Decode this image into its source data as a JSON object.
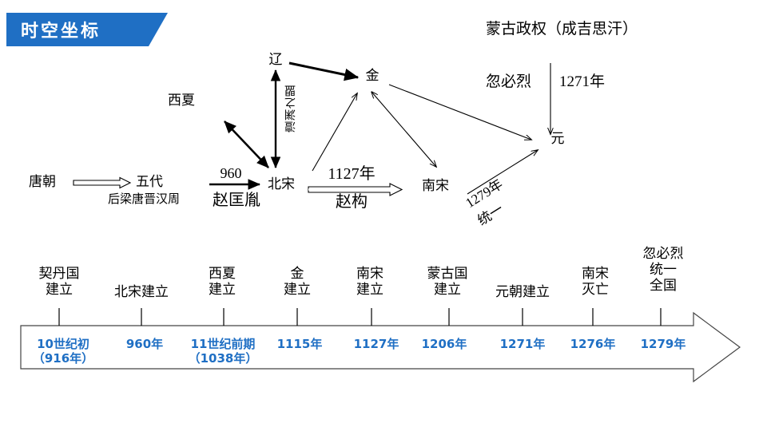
{
  "banner": {
    "title": "时空坐标"
  },
  "colors": {
    "brand": "#1f6fc4",
    "accent": "#1f6fc4",
    "line": "#000000"
  },
  "diagram": {
    "heading": "蒙古政权（成吉思汗）",
    "nodes": [
      {
        "id": "tang",
        "label": "唐朝"
      },
      {
        "id": "wudai",
        "label": "五代"
      },
      {
        "id": "wudai2",
        "label": "后梁唐晋汉周"
      },
      {
        "id": "xixia",
        "label": "西夏"
      },
      {
        "id": "liao",
        "label": "辽"
      },
      {
        "id": "beisong",
        "label": "北宋"
      },
      {
        "id": "jin",
        "label": "金"
      },
      {
        "id": "nansong",
        "label": "南宋"
      },
      {
        "id": "yuan",
        "label": "元"
      }
    ],
    "edge_labels": {
      "tang_to_wudai": "",
      "wudai_to_beisong_year": "960",
      "wudai_to_beisong_person": "赵匡胤",
      "beisong_to_nansong_year": "1127年",
      "beisong_to_nansong_person": "赵构",
      "liao_beisong_treaty": "澶渊之盟",
      "mongol_to_yuan_person": "忽必烈",
      "mongol_to_yuan_year": "1271年",
      "unify_year": "1279年",
      "unify_word": "统一"
    }
  },
  "timeline": {
    "events": [
      {
        "label": "契丹国\n建立",
        "year": "10世纪初\n（916年）"
      },
      {
        "label": "北宋建立",
        "year": "960年"
      },
      {
        "label": "西夏\n建立",
        "year": "11世纪前期\n（1038年）"
      },
      {
        "label": "金\n建立",
        "year": "1115年"
      },
      {
        "label": "南宋\n建立",
        "year": "1127年"
      },
      {
        "label": "蒙古国\n建立",
        "year": "1206年"
      },
      {
        "label": "元朝建立",
        "year": "1271年"
      },
      {
        "label": "南宋\n灭亡",
        "year": "1276年"
      },
      {
        "label": "忽必烈\n统一\n全国",
        "year": "1279年"
      }
    ]
  }
}
